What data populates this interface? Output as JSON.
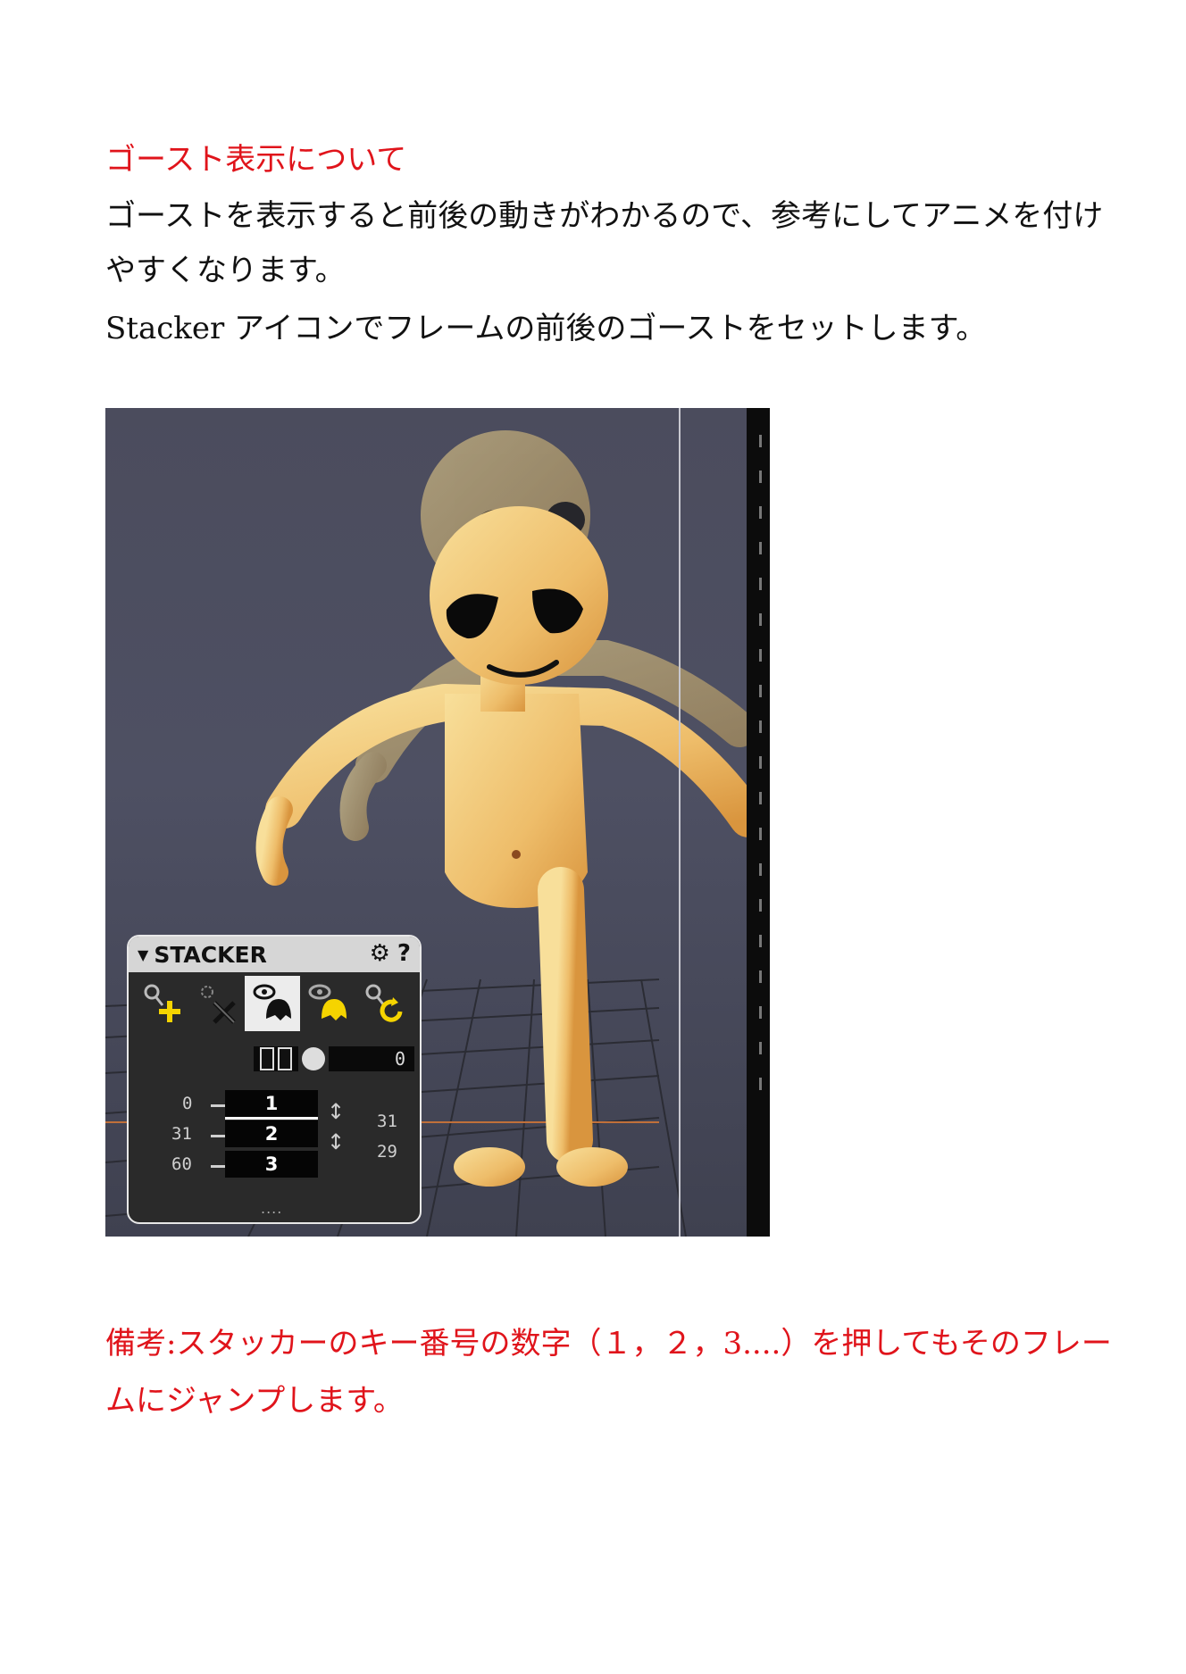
{
  "heading": "ゴースト表示について",
  "paragraph1": "ゴーストを表示すると前後の動きがわかるので、参考にしてアニメを付けやすくなります。",
  "paragraph2": "Stacker アイコンでフレームの前後のゴーストをセットします。",
  "note": "備考:スタッカーのキー番号の数字（１，２，3....）を押してもそのフレームにジャンプします。",
  "stacker": {
    "title": "STACKER",
    "offset_value": "0",
    "keys": [
      {
        "label": "1",
        "frame": "0"
      },
      {
        "label": "2",
        "frame": "31"
      },
      {
        "label": "3",
        "frame": "60"
      }
    ],
    "intervals": [
      "31",
      "29"
    ],
    "tools": [
      "add-key-icon",
      "remove-key-icon",
      "ghost-visible-icon",
      "ghost-color-icon",
      "refresh-key-icon"
    ]
  },
  "colors": {
    "heading": "#e0141b",
    "note": "#e0141b",
    "viewport_bg": "#4b4c5d",
    "accent_yellow": "#f5d400"
  }
}
